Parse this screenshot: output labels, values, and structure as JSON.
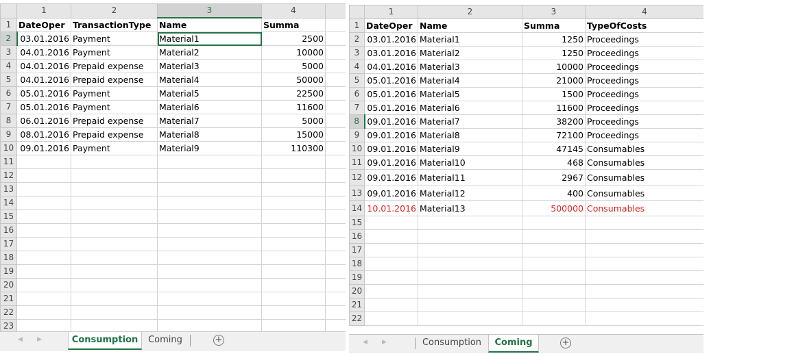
{
  "left": {
    "col_headers": [
      "1",
      "2",
      "3",
      "4",
      ""
    ],
    "selected_col": 2,
    "selected_row": 2,
    "rows": [
      [
        "DateOper",
        "TransactionType",
        "Name",
        "Summa",
        ""
      ],
      [
        "03.01.2016",
        "Payment",
        "Material1",
        "2500",
        ""
      ],
      [
        "04.01.2016",
        "Payment",
        "Material2",
        "10000",
        ""
      ],
      [
        "04.01.2016",
        "Prepaid expense",
        "Material3",
        "5000",
        ""
      ],
      [
        "04.01.2016",
        "Prepaid expense",
        "Material4",
        "50000",
        ""
      ],
      [
        "05.01.2016",
        "Payment",
        "Material5",
        "22500",
        ""
      ],
      [
        "05.01.2016",
        "Payment",
        "Material6",
        "11600",
        ""
      ],
      [
        "06.01.2016",
        "Prepaid expense",
        "Material7",
        "5000",
        ""
      ],
      [
        "08.01.2016",
        "Prepaid expense",
        "Material8",
        "15000",
        ""
      ],
      [
        "09.01.2016",
        "Payment",
        "Material9",
        "110300",
        ""
      ]
    ],
    "total_rows": 23,
    "tabs": [
      "Consumption",
      "Coming"
    ],
    "active_tab": 0
  },
  "right": {
    "col_headers": [
      "1",
      "2",
      "3",
      "4"
    ],
    "selected_row": 8,
    "rows": [
      [
        "DateOper",
        "Name",
        "Summa",
        "TypeOfCosts"
      ],
      [
        "03.01.2016",
        "Material1",
        "1250",
        "Proceedings"
      ],
      [
        "03.01.2016",
        "Material2",
        "1250",
        "Proceedings"
      ],
      [
        "04.01.2016",
        "Material3",
        "10000",
        "Proceedings"
      ],
      [
        "05.01.2016",
        "Material4",
        "21000",
        "Proceedings"
      ],
      [
        "05.01.2016",
        "Material5",
        "1500",
        "Proceedings"
      ],
      [
        "05.01.2016",
        "Material6",
        "11600",
        "Proceedings"
      ],
      [
        "09.01.2016",
        "Material7",
        "38200",
        "Proceedings"
      ],
      [
        "09.01.2016",
        "Material8",
        "72100",
        "Proceedings"
      ],
      [
        "09.01.2016",
        "Material9",
        "47145",
        "Consumables"
      ],
      [
        "09.01.2016",
        "Material10",
        "468",
        "Consumables"
      ],
      [
        "09.01.2016",
        "Material11",
        "2967",
        "Consumables"
      ],
      [
        "09.01.2016",
        "Material12",
        "400",
        "Consumables"
      ],
      [
        "10.01.2016",
        "Material13",
        "500000",
        "Consumables"
      ]
    ],
    "highlight_row": 14,
    "highlight_color": "#e02020",
    "total_rows": 22,
    "tabs": [
      "Consumption",
      "Coming"
    ],
    "active_tab": 1
  },
  "accent": "#217346"
}
